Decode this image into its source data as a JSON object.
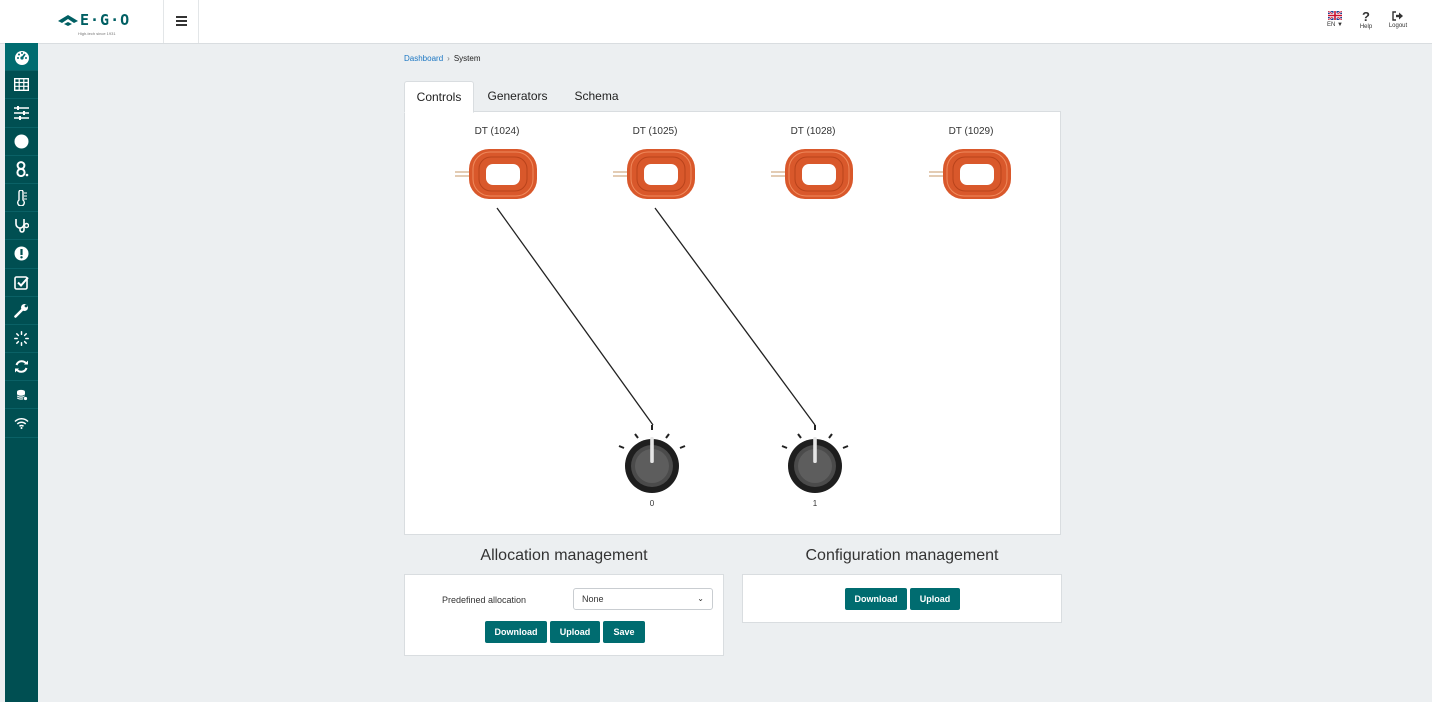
{
  "header": {
    "brand": "E·G·O",
    "tagline": "High-tech since 1931",
    "language": "EN",
    "help_label": "Help",
    "logout_label": "Logout"
  },
  "sidebar": {
    "items": [
      {
        "icon": "dashboard-icon",
        "active": true
      },
      {
        "icon": "table-icon"
      },
      {
        "icon": "sliders-icon"
      },
      {
        "icon": "circle-icon"
      },
      {
        "icon": "cooking-zones-icon"
      },
      {
        "icon": "thermometer-icon"
      },
      {
        "icon": "stethoscope-icon"
      },
      {
        "icon": "alert-icon"
      },
      {
        "icon": "checklist-icon"
      },
      {
        "icon": "wrench-icon"
      },
      {
        "icon": "spinner-icon"
      },
      {
        "icon": "sync-icon"
      },
      {
        "icon": "database-icon"
      },
      {
        "icon": "wifi-icon"
      }
    ]
  },
  "breadcrumb": {
    "root": "Dashboard",
    "separator": "›",
    "current": "System"
  },
  "tabs": [
    {
      "label": "Controls",
      "active": true
    },
    {
      "label": "Generators"
    },
    {
      "label": "Schema"
    }
  ],
  "coils": [
    {
      "label": "DT (1024)"
    },
    {
      "label": "DT (1025)"
    },
    {
      "label": "DT (1028)"
    },
    {
      "label": "DT (1029)"
    }
  ],
  "knobs": [
    {
      "value": "0"
    },
    {
      "value": "1"
    }
  ],
  "allocation": {
    "title": "Allocation management",
    "select_label": "Predefined allocation",
    "select_value": "None",
    "download_label": "Download",
    "upload_label": "Upload",
    "save_label": "Save"
  },
  "configuration": {
    "title": "Configuration management",
    "download_label": "Download",
    "upload_label": "Upload"
  },
  "colors": {
    "primary": "#006c70",
    "sidebar": "#004f52",
    "coil": "#d9582b",
    "link": "#1c77c3"
  }
}
